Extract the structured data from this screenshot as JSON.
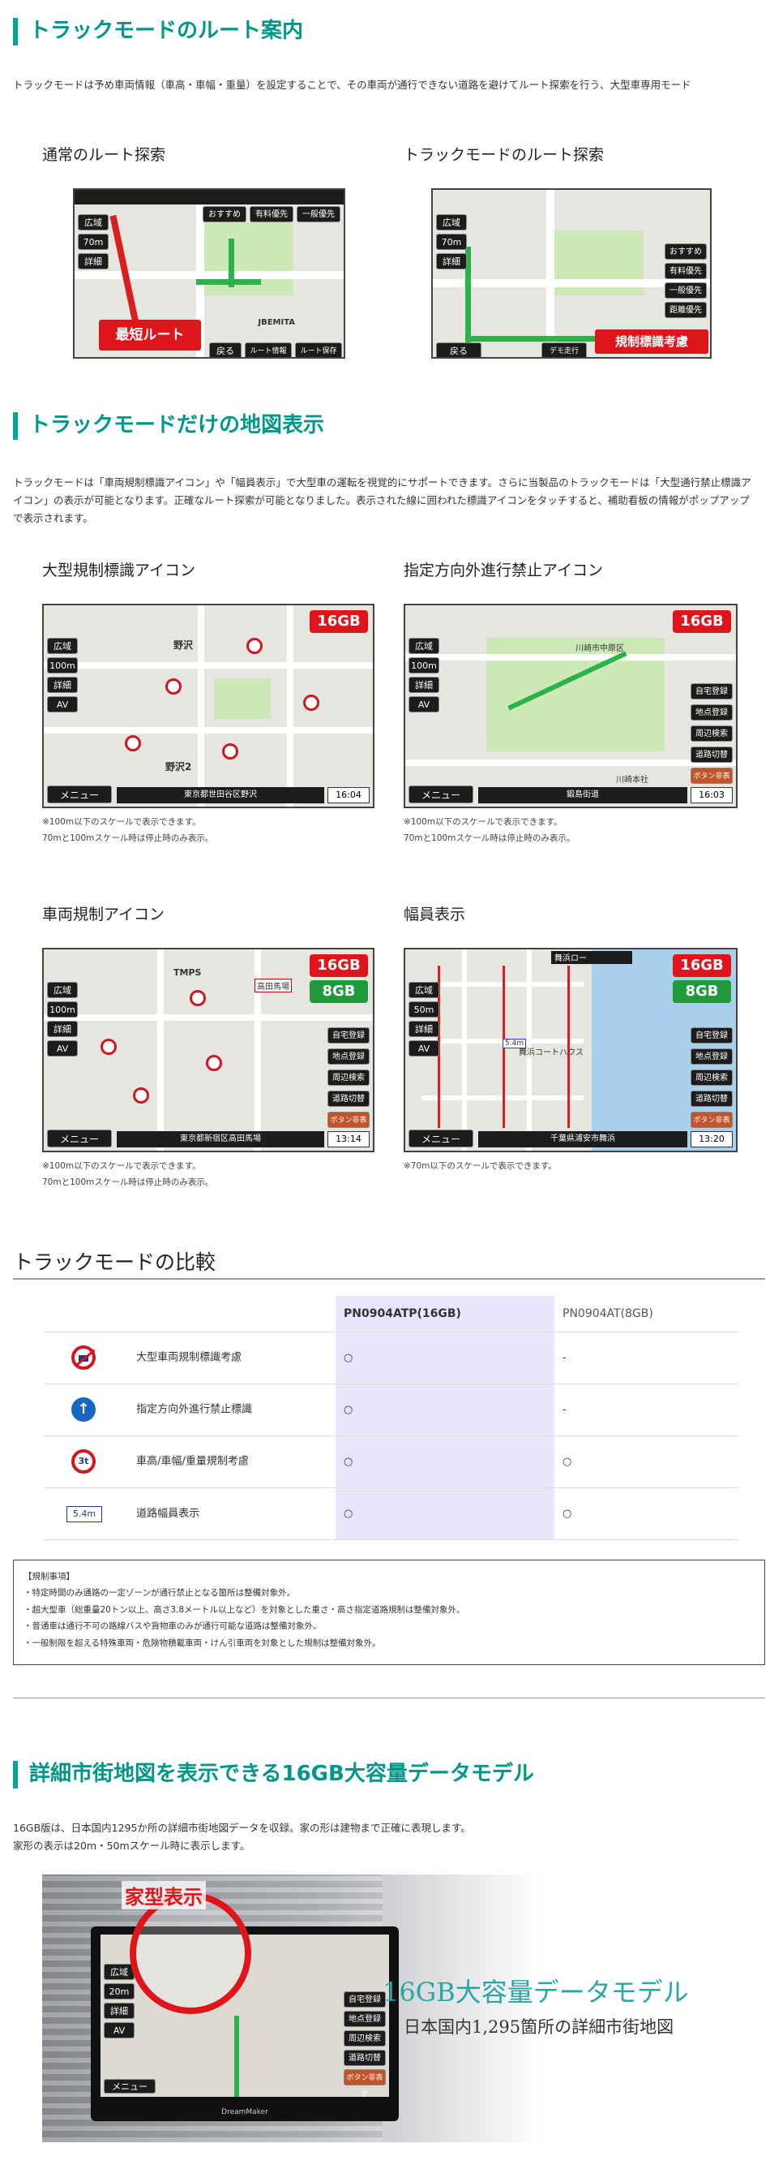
{
  "section1": {
    "title": "トラックモードのルート案内",
    "desc": "トラックモードは予め車両情報（車高・車幅・重量）を設定することで、その車両が通行できない道路を避けてルート探索を行う、大型車専用モード"
  },
  "normal_route": {
    "title": "通常のルート探索",
    "callout": "最短ルート",
    "tabs": [
      "おすすめ",
      "有料優先",
      "一般優先"
    ],
    "left_buttons": [
      "広域",
      "70m",
      "詳細"
    ],
    "bottom_buttons": [
      "戻る",
      "ルート情報",
      "ルート保存"
    ],
    "label": "JBEMITA"
  },
  "truck_route": {
    "title": "トラックモードのルート探索",
    "callout": "規制標識考慮",
    "right_buttons": [
      "おすすめ",
      "有料優先",
      "一般優先",
      "距離優先"
    ],
    "left_buttons": [
      "広域",
      "70m",
      "詳細"
    ],
    "bottom_buttons": [
      "戻る",
      "デモ走行"
    ]
  },
  "section2": {
    "title": "トラックモードだけの地図表示",
    "desc": "トラックモードは「車両規制標識アイコン」や「幅員表示」で大型車の運転を視覚的にサポートできます。さらに当製品のトラックモードは「大型通行禁止標識アイコン」の表示が可能となります。正確なルート探索が可能となりました。表示された線に囲われた標識アイコンをタッチすると、補助看板の情報がポップアップで表示されます。"
  },
  "map1": {
    "title": "大型規制標識アイコン",
    "badge": "16GB",
    "left_buttons": [
      "広域",
      "100m",
      "詳細",
      "AV"
    ],
    "menu": "メニュー",
    "address": "東京都世田谷区野沢",
    "clock": "16:04",
    "place1": "野沢",
    "place2": "野沢2",
    "note1": "※100m以下のスケールで表示できます。",
    "note2": "70mと100mスケール時は停止時のみ表示。"
  },
  "map2": {
    "title": "指定方向外進行禁止アイコン",
    "badge": "16GB",
    "left_buttons": [
      "広域",
      "100m",
      "詳細",
      "AV"
    ],
    "right_buttons": [
      "自宅登録",
      "地点登録",
      "周辺検索",
      "道路切替",
      "ボタン非表示"
    ],
    "menu": "メニュー",
    "address": "鍛島街道",
    "clock": "16:03",
    "label1": "川崎市中原区",
    "label2": "川崎本社",
    "note1": "※100m以下のスケールで表示できます。",
    "note2": "70mと100mスケール時は停止時のみ表示。"
  },
  "map3": {
    "title": "車両規制アイコン",
    "badge1": "16GB",
    "badge2": "8GB",
    "left_buttons": [
      "広域",
      "100m",
      "詳細",
      "AV"
    ],
    "right_buttons": [
      "自宅登録",
      "地点登録",
      "周辺検索",
      "道路切替",
      "ボタン非表示"
    ],
    "menu": "メニュー",
    "address": "東京都新宿区高田馬場",
    "clock": "13:14",
    "label1": "高田馬場",
    "label2": "TMPS",
    "note1": "※100m以下のスケールで表示できます。",
    "note2": "70mと100mスケール時は停止時のみ表示。"
  },
  "map4": {
    "title": "幅員表示",
    "badge1": "16GB",
    "badge2": "8GB",
    "left_buttons": [
      "広域",
      "50m",
      "詳細",
      "AV"
    ],
    "right_buttons": [
      "自宅登録",
      "地点登録",
      "周辺検索",
      "道路切替",
      "ボタン非表示"
    ],
    "menu": "メニュー",
    "address": "千葉県浦安市舞浜",
    "clock": "13:20",
    "width_label": "5.4m",
    "label1": "舞浜ロー",
    "label2": "舞浜コートハウス",
    "note1": "※70m以下のスケールで表示できます。"
  },
  "comparison": {
    "title": "トラックモードの比較",
    "col1": "PN0904ATP(16GB)",
    "col2": "PN0904AT(8GB)",
    "rows": [
      {
        "label": "大型車両規制標識考慮",
        "icon": "no-large-vehicle-sign-icon",
        "v1": "○",
        "v2": "-"
      },
      {
        "label": "指定方向外進行禁止標識",
        "icon": "direction-arrow-sign-icon",
        "v1": "○",
        "v2": "-"
      },
      {
        "label": "車高/車幅/重量規制考慮",
        "icon": "weight-limit-sign-icon",
        "v1": "○",
        "v2": "○"
      },
      {
        "label": "道路幅員表示",
        "icon": "road-width-sign-icon",
        "v1": "○",
        "v2": "○"
      }
    ],
    "icon_text_weight": "3t",
    "icon_text_width": "5.4m"
  },
  "notice": {
    "title": "【規制事項】",
    "items": [
      "・特定時間のみ通路の一定ゾーンが通行禁止となる箇所は整備対象外。",
      "・超大型車（総重量20トン以上、高さ3.8メートル以上など）を対象とした重さ・高さ指定道路規制は整備対象外。",
      "・普通車は通行不可の路線バスや貨物車のみが通行可能な道路は整備対象外。",
      "・一般制限を超える特殊車両・危険物積載車両・けん引車両を対象とした規制は整備対象外。"
    ]
  },
  "section3": {
    "title": "詳細市街地図を表示できる16GB大容量データモデル",
    "desc1": "16GB版は、日本国内1295か所の詳細市街地図データを収録。家の形は建物まで正確に表現します。",
    "desc2": "家形の表示は20m・50mスケール時に表示します。",
    "hero_title": "16GB大容量データモデル",
    "hero_sub": "日本国内1,295箇所の詳細市街地図",
    "bubble": "家型表示",
    "brand": "DreamMaker",
    "device_menu": "メニュー",
    "device_right_buttons": [
      "自宅登録",
      "地点登録",
      "周辺検索",
      "道路切替",
      "ボタン非表示"
    ],
    "device_left_buttons": [
      "広域",
      "20m",
      "詳細",
      "AV"
    ]
  }
}
